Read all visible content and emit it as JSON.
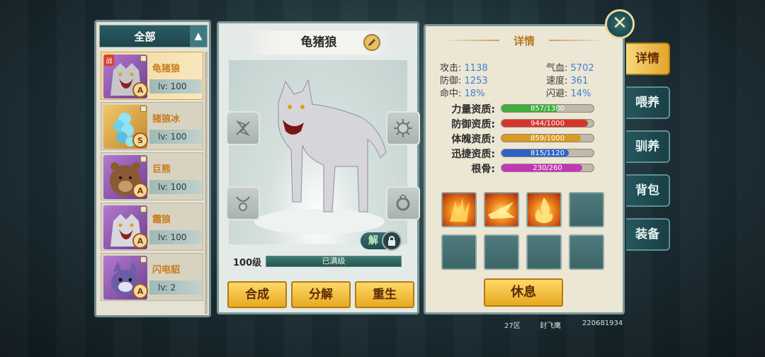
{
  "filter": {
    "label": "全部",
    "toggle_icon": "chevron-up-icon"
  },
  "pets": [
    {
      "name": "龟猪狼",
      "level": "lv: 100",
      "grade": "A",
      "theme": "purple",
      "selected": true,
      "battle_tag": "战"
    },
    {
      "name": "猪狼冰",
      "level": "lv: 100",
      "grade": "S",
      "theme": "gold",
      "selected": false
    },
    {
      "name": "巨熊",
      "level": "lv: 100",
      "grade": "A",
      "theme": "purple",
      "selected": false
    },
    {
      "name": "霜狼",
      "level": "lv: 100",
      "grade": "A",
      "theme": "purple",
      "selected": false
    },
    {
      "name": "闪电貂",
      "level": "lv: 2",
      "grade": "A",
      "theme": "purple",
      "selected": false
    }
  ],
  "center": {
    "pet_name": "龟猪狼",
    "unlock_label": "解",
    "level_label": "100级",
    "exp_text": "已满级",
    "exp_fraction": 1.0,
    "buttons": {
      "synthesize": "合成",
      "decompose": "分解",
      "reborn": "重生"
    }
  },
  "details": {
    "title": "详情",
    "stats": {
      "attack_label": "攻击:",
      "attack": "1138",
      "hp_label": "气血:",
      "hp": "5702",
      "defense_label": "防御:",
      "defense": "1253",
      "speed_label": "速度:",
      "speed": "361",
      "hit_label": "命中:",
      "hit": "18%",
      "dodge_label": "闪避:",
      "dodge": "14%"
    },
    "aptitudes": [
      {
        "label": "力量资质:",
        "text": "857/1380",
        "value": 857,
        "max": 1380,
        "color": "#3fae3c"
      },
      {
        "label": "防御资质:",
        "text": "944/1000",
        "value": 944,
        "max": 1000,
        "color": "#d8322c"
      },
      {
        "label": "体魄资质:",
        "text": "859/1000",
        "value": 859,
        "max": 1000,
        "color": "#d99a24"
      },
      {
        "label": "迅捷资质:",
        "text": "815/1120",
        "value": 815,
        "max": 1120,
        "color": "#2f62c8"
      },
      {
        "label": "根骨:",
        "text": "230/260",
        "value": 230,
        "max": 260,
        "color": "#c336b8"
      }
    ],
    "skills_filled": 3,
    "skills_total": 8,
    "rest_button": "休息"
  },
  "tabs": [
    {
      "label": "详情",
      "active": true
    },
    {
      "label": "喂养",
      "active": false
    },
    {
      "label": "驯养",
      "active": false
    },
    {
      "label": "背包",
      "active": false
    },
    {
      "label": "装备",
      "active": false
    }
  ],
  "close_icon": "close-icon",
  "footer": {
    "server": "27区",
    "player": "封飞鹰",
    "id": "220681934"
  }
}
